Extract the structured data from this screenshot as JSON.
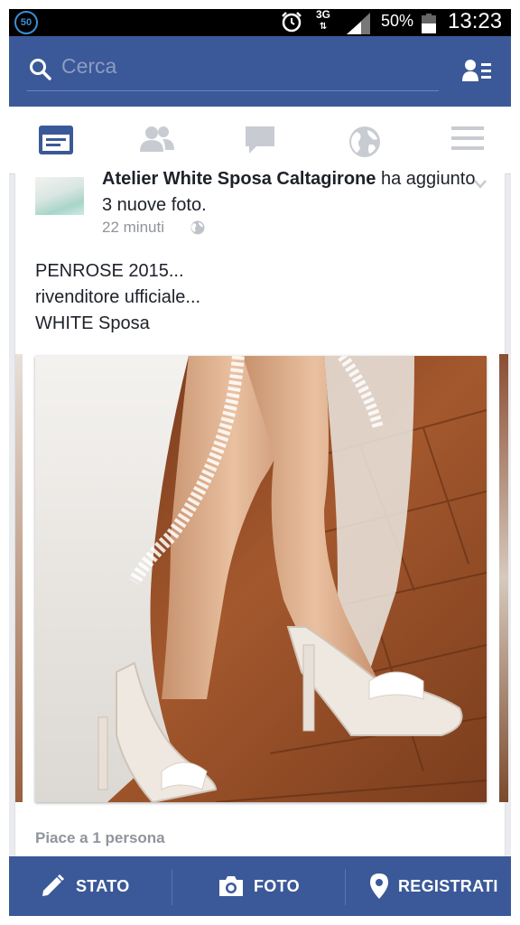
{
  "status_bar": {
    "notification_count": "50",
    "network": "3G",
    "battery_percent": "50%",
    "time": "13:23"
  },
  "search": {
    "placeholder": "Cerca"
  },
  "tabs": [
    {
      "name": "news-feed",
      "icon": "news-feed-icon",
      "active": true
    },
    {
      "name": "friend-requests",
      "icon": "friends-icon",
      "active": false
    },
    {
      "name": "messages",
      "icon": "chat-bubble-icon",
      "active": false
    },
    {
      "name": "notifications",
      "icon": "globe-icon",
      "active": false
    },
    {
      "name": "more",
      "icon": "hamburger-menu-icon",
      "active": false
    }
  ],
  "post": {
    "author": "Atelier White Sposa Caltagirone",
    "action": " ha aggiunto 3 nuove foto.",
    "time": "22 minuti",
    "text_lines": [
      "PENROSE 2015...",
      "rivenditore ufficiale...",
      "WHITE Sposa"
    ],
    "likes": "Piace a 1 persona"
  },
  "composer": {
    "status": "STATO",
    "photo": "FOTO",
    "checkin": "REGISTRATI"
  },
  "colors": {
    "brand": "#3b5998",
    "muted": "#90949c"
  }
}
